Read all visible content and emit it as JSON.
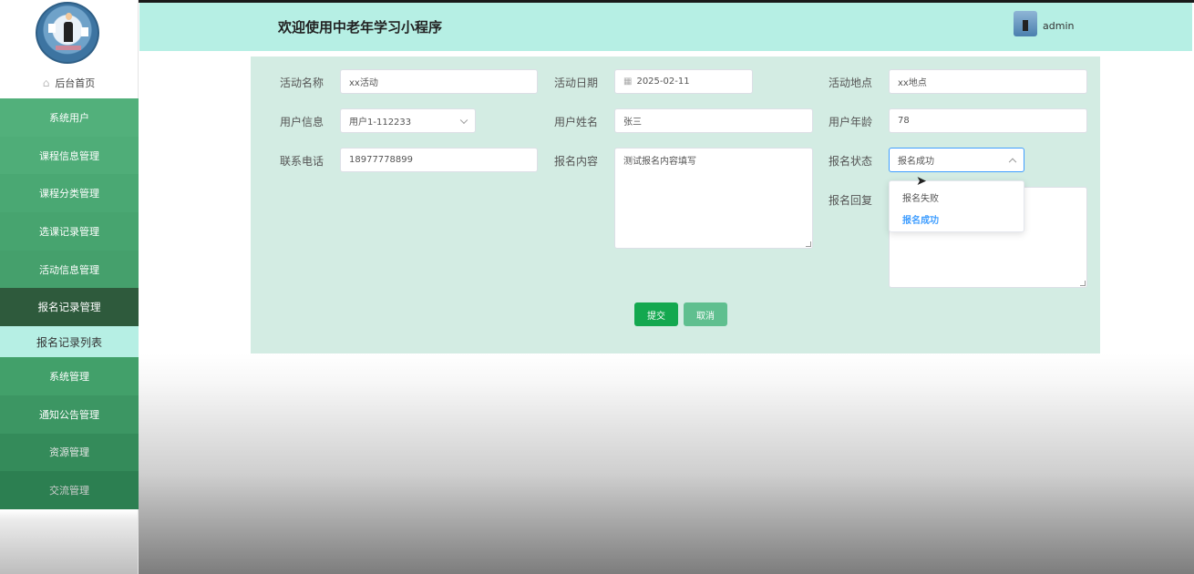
{
  "header": {
    "title": "欢迎使用中老年学习小程序",
    "username": "admin"
  },
  "sidebar": {
    "home_label": "后台首页",
    "items": [
      {
        "label": "系统用户"
      },
      {
        "label": "课程信息管理"
      },
      {
        "label": "课程分类管理"
      },
      {
        "label": "选课记录管理"
      },
      {
        "label": "活动信息管理"
      },
      {
        "label": "报名记录管理"
      },
      {
        "label": "报名记录列表"
      },
      {
        "label": "系统管理"
      },
      {
        "label": "通知公告管理"
      },
      {
        "label": "资源管理"
      },
      {
        "label": "交流管理"
      }
    ]
  },
  "form": {
    "activity_name": {
      "label": "活动名称",
      "value": "xx活动"
    },
    "activity_date": {
      "label": "活动日期",
      "value": "2025-02-11"
    },
    "activity_location": {
      "label": "活动地点",
      "value": "xx地点"
    },
    "user_info": {
      "label": "用户信息",
      "value": "用户1-112233"
    },
    "user_name": {
      "label": "用户姓名",
      "value": "张三"
    },
    "user_age": {
      "label": "用户年龄",
      "value": "78"
    },
    "phone": {
      "label": "联系电话",
      "value": "18977778899"
    },
    "signup_content": {
      "label": "报名内容",
      "value": "测试报名内容填写"
    },
    "signup_status": {
      "label": "报名状态",
      "value": "报名成功",
      "options": [
        "报名失败",
        "报名成功"
      ]
    },
    "signup_reply": {
      "label": "报名回复",
      "value": ""
    },
    "submit_label": "提交",
    "cancel_label": "取消"
  },
  "colors": {
    "header_bg": "#b6efe4",
    "menu_green": "#52b07b",
    "menu_active": "#2e5a3c",
    "panel_bg": "#d3ece3",
    "submit": "#13a84f",
    "cancel": "#5fbf8f",
    "selected_option": "#409eff"
  }
}
